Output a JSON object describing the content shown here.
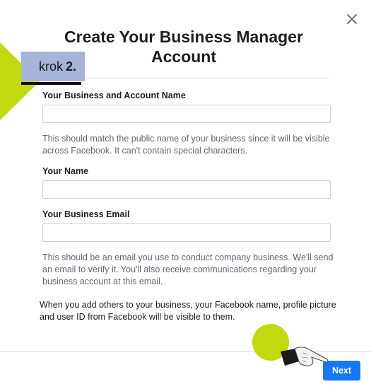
{
  "dialog": {
    "title": "Create Your Business Manager Account",
    "close_icon": "close-icon"
  },
  "overlay": {
    "step_word": "krok",
    "step_number": "2.",
    "accent_color": "#c2d80f",
    "badge_color": "#a7b4d8"
  },
  "form": {
    "business_name": {
      "label": "Your Business and Account Name",
      "value": "",
      "help": "This should match the public name of your business since it will be visible across Facebook. It can't contain special characters."
    },
    "your_name": {
      "label": "Your Name",
      "value": ""
    },
    "business_email": {
      "label": "Your Business Email",
      "value": "",
      "help": "This should be an email you use to conduct company business. We'll send an email to verify it. You'll also receive communications regarding your business account at this email."
    },
    "notice": "When you add others to your business, your Facebook name, profile picture and user ID from Facebook will be visible to them."
  },
  "footer": {
    "next_label": "Next",
    "next_color": "#1877f2"
  }
}
